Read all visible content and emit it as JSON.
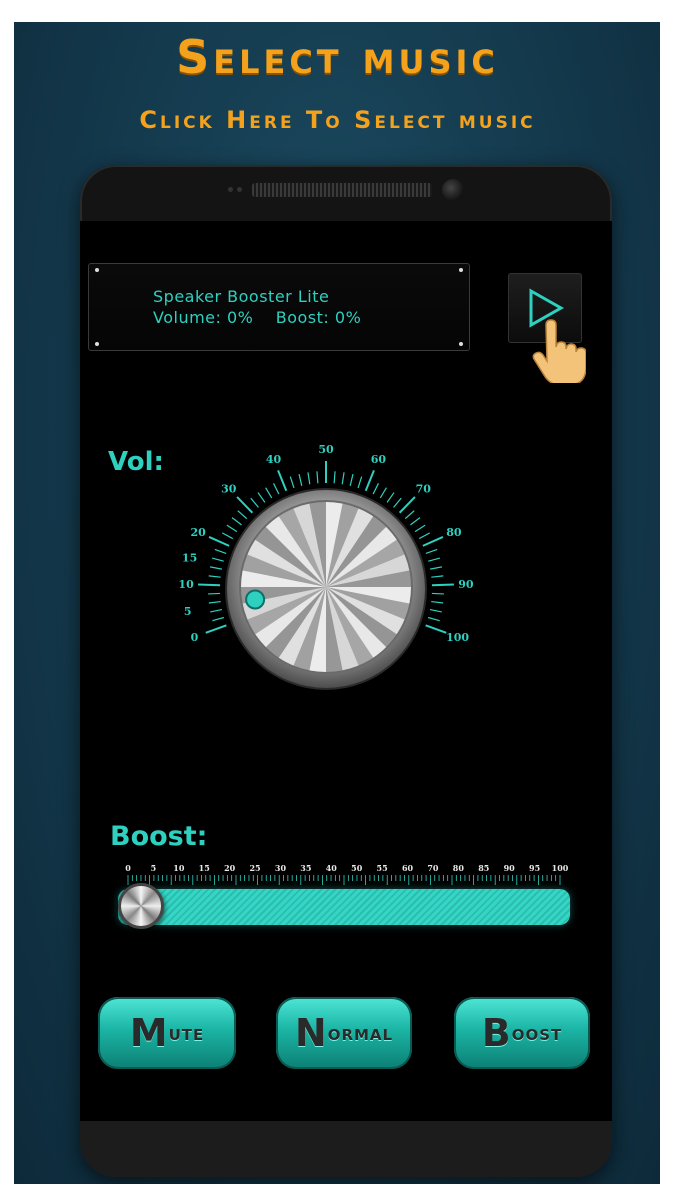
{
  "header": {
    "title": "Select music",
    "subtitle": "Click Here To Select music"
  },
  "display": {
    "app_name": "Speaker Booster Lite",
    "volume_label": "Volume:",
    "volume_value": "0%",
    "boost_label": "Boost:",
    "boost_value": "0%"
  },
  "volume": {
    "label": "Vol:",
    "scale_ticks": [
      "0",
      "5",
      "10",
      "15",
      "20",
      "30",
      "40",
      "50",
      "60",
      "70",
      "80",
      "90",
      "100"
    ],
    "value": 0
  },
  "boost": {
    "label": "Boost:",
    "scale_ticks": [
      "0",
      "5",
      "10",
      "15",
      "20",
      "25",
      "30",
      "35",
      "40",
      "50",
      "55",
      "60",
      "70",
      "80",
      "85",
      "90",
      "95",
      "100"
    ],
    "value": 0
  },
  "buttons": {
    "mute": {
      "first": "M",
      "rest": "ute"
    },
    "normal": {
      "first": "N",
      "rest": "ormal"
    },
    "boost": {
      "first": "B",
      "rest": "oost"
    }
  },
  "icons": {
    "play": "play-icon",
    "hand": "hand-pointer-icon"
  },
  "colors": {
    "accent": "#2ed0c0",
    "title": "#f4a21c"
  }
}
